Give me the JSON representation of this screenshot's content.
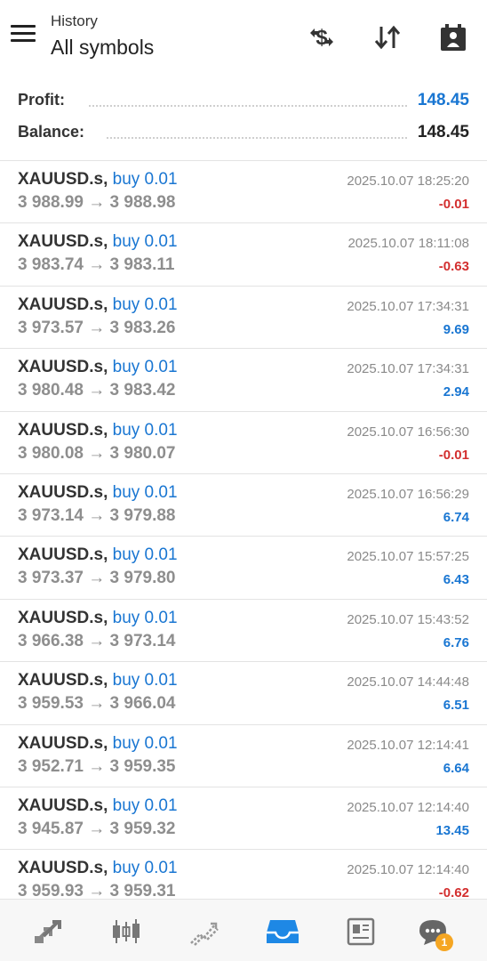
{
  "header": {
    "subtitle": "History",
    "title": "All symbols"
  },
  "summary": {
    "profit_label": "Profit:",
    "profit_value": "148.45",
    "balance_label": "Balance:",
    "balance_value": "148.45"
  },
  "trades": [
    {
      "symbol": "XAUUSD.s,",
      "side": "buy 0.01",
      "open": "3 988.99",
      "close": "3 988.98",
      "time": "2025.10.07 18:25:20",
      "profit": "-0.01",
      "dir": "neg"
    },
    {
      "symbol": "XAUUSD.s,",
      "side": "buy 0.01",
      "open": "3 983.74",
      "close": "3 983.11",
      "time": "2025.10.07 18:11:08",
      "profit": "-0.63",
      "dir": "neg"
    },
    {
      "symbol": "XAUUSD.s,",
      "side": "buy 0.01",
      "open": "3 973.57",
      "close": "3 983.26",
      "time": "2025.10.07 17:34:31",
      "profit": "9.69",
      "dir": "pos"
    },
    {
      "symbol": "XAUUSD.s,",
      "side": "buy 0.01",
      "open": "3 980.48",
      "close": "3 983.42",
      "time": "2025.10.07 17:34:31",
      "profit": "2.94",
      "dir": "pos"
    },
    {
      "symbol": "XAUUSD.s,",
      "side": "buy 0.01",
      "open": "3 980.08",
      "close": "3 980.07",
      "time": "2025.10.07 16:56:30",
      "profit": "-0.01",
      "dir": "neg"
    },
    {
      "symbol": "XAUUSD.s,",
      "side": "buy 0.01",
      "open": "3 973.14",
      "close": "3 979.88",
      "time": "2025.10.07 16:56:29",
      "profit": "6.74",
      "dir": "pos"
    },
    {
      "symbol": "XAUUSD.s,",
      "side": "buy 0.01",
      "open": "3 973.37",
      "close": "3 979.80",
      "time": "2025.10.07 15:57:25",
      "profit": "6.43",
      "dir": "pos"
    },
    {
      "symbol": "XAUUSD.s,",
      "side": "buy 0.01",
      "open": "3 966.38",
      "close": "3 973.14",
      "time": "2025.10.07 15:43:52",
      "profit": "6.76",
      "dir": "pos"
    },
    {
      "symbol": "XAUUSD.s,",
      "side": "buy 0.01",
      "open": "3 959.53",
      "close": "3 966.04",
      "time": "2025.10.07 14:44:48",
      "profit": "6.51",
      "dir": "pos"
    },
    {
      "symbol": "XAUUSD.s,",
      "side": "buy 0.01",
      "open": "3 952.71",
      "close": "3 959.35",
      "time": "2025.10.07 12:14:41",
      "profit": "6.64",
      "dir": "pos"
    },
    {
      "symbol": "XAUUSD.s,",
      "side": "buy 0.01",
      "open": "3 945.87",
      "close": "3 959.32",
      "time": "2025.10.07 12:14:40",
      "profit": "13.45",
      "dir": "pos"
    },
    {
      "symbol": "XAUUSD.s,",
      "side": "buy 0.01",
      "open": "3 959.93",
      "close": "3 959.31",
      "time": "2025.10.07 12:14:40",
      "profit": "-0.62",
      "dir": "neg"
    }
  ],
  "arrow_glyph": "→",
  "icons": {
    "menu": "hamburger-icon",
    "currency": "currency-exchange-icon",
    "sort": "sort-icon",
    "calendar": "calendar-person-icon"
  },
  "nav": [
    {
      "name": "quotes",
      "icon": "quotes-arrows-icon"
    },
    {
      "name": "chart",
      "icon": "candlestick-chart-icon"
    },
    {
      "name": "trade",
      "icon": "trade-chart-icon"
    },
    {
      "name": "history",
      "icon": "inbox-icon",
      "active": true
    },
    {
      "name": "news",
      "icon": "newspaper-icon"
    },
    {
      "name": "messages",
      "icon": "chat-icon",
      "badge": "1"
    }
  ],
  "colors": {
    "accent": "#1976d2",
    "negative": "#d32f2f",
    "badge": "#f5a623"
  }
}
